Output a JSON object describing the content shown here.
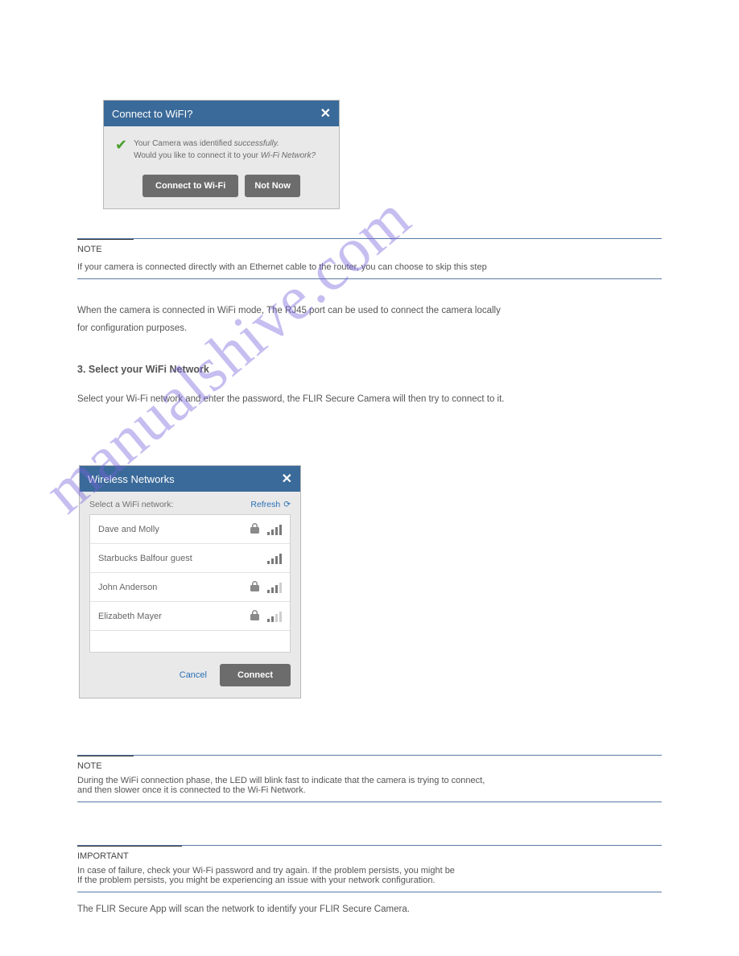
{
  "watermark": "manualshive.com",
  "dialog1": {
    "title": "Connect to WiFI?",
    "line1_a": "Your Camera was identified ",
    "line1_b": "successfully.",
    "line2_a": "Would you like to connect it to your ",
    "line2_b": "Wi-Fi Network?",
    "btn_connect": "Connect to Wi-Fi",
    "btn_notnow": "Not Now"
  },
  "note1": {
    "label": "NOTE",
    "text": "If your camera is connected directly with an Ethernet cable to the router, you can choose to skip this step"
  },
  "para1": "When the camera is connected in WiFi mode, The RJ45 port can be used to connect the camera locally",
  "para2": "for configuration purposes.",
  "section_title": "3. Select your WiFi Network",
  "section_sub": "Select your Wi-Fi network and enter the password, the FLIR Secure Camera will then try to connect to it.",
  "dialog2": {
    "title": "Wireless Networks",
    "select_label": "Select a WiFi network:",
    "refresh": "Refresh",
    "networks": [
      {
        "name": "Dave and Molly",
        "locked": true,
        "strength": "full"
      },
      {
        "name": "Starbucks Balfour guest",
        "locked": false,
        "strength": "full"
      },
      {
        "name": "John Anderson",
        "locked": true,
        "strength": "3"
      },
      {
        "name": "Elizabeth Mayer",
        "locked": true,
        "strength": "2"
      }
    ],
    "cancel": "Cancel",
    "connect": "Connect"
  },
  "note2": {
    "label": "NOTE",
    "text_a": "During the WiFi connection phase, the LED will blink fast to indicate that the camera is trying to connect,",
    "text_b": "and then slower once it is connected to the Wi-Fi Network."
  },
  "note3": {
    "label": "IMPORTANT",
    "text_a": "In case of failure, check your Wi-Fi password and try again. If the problem persists, you might be",
    "text_b": "If the problem persists, you might be experiencing an issue with your network configuration."
  },
  "after_note3": "The FLIR Secure App will scan the network to identify your FLIR Secure Camera."
}
